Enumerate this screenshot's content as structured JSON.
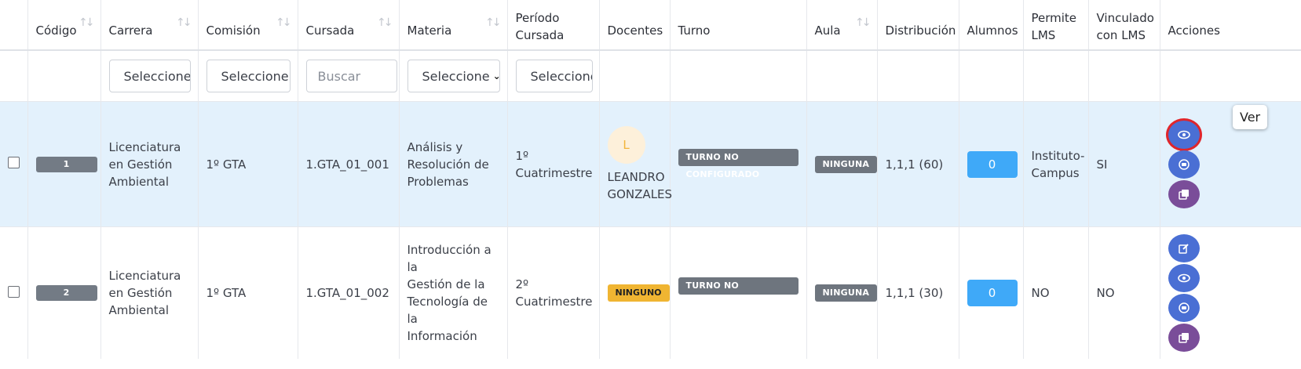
{
  "headers": {
    "codigo": "Código",
    "carrera": "Carrera",
    "comision": "Comisión",
    "cursada": "Cursada",
    "materia": "Materia",
    "periodo": [
      "Período",
      "Cursada"
    ],
    "docentes": "Docentes",
    "turno": "Turno",
    "aula": "Aula",
    "distribucion": "Distribución",
    "alumnos": "Alumnos",
    "permite": [
      "Permite",
      "LMS"
    ],
    "vinculado": [
      "Vinculado",
      "con LMS"
    ],
    "acciones": "Acciones"
  },
  "filters": {
    "carrera": "Seleccione",
    "comision": "Seleccione",
    "cursada_placeholder": "Buscar",
    "materia": "Seleccione",
    "periodo": "Seleccione"
  },
  "rows": [
    {
      "codigo": "1",
      "carrera": [
        "Licenciatura",
        "en Gestión",
        "Ambiental"
      ],
      "comision": "1º GTA",
      "cursada": "1.GTA_01_001",
      "materia": [
        "Análisis y",
        "Resolución de",
        "Problemas"
      ],
      "periodo": [
        "1º",
        "Cuatrimestre"
      ],
      "docente_initial": "L",
      "docente_name": [
        "LEANDRO",
        "GONZALES"
      ],
      "turno": "TURNO NO CONFIGURADO",
      "aula": "NINGUNA",
      "distribucion": "1,1,1 (60)",
      "alumnos": "0",
      "permite": [
        "Instituto-",
        "Campus"
      ],
      "vinculado": "SI"
    },
    {
      "codigo": "2",
      "carrera": [
        "Licenciatura",
        "en Gestión",
        "Ambiental"
      ],
      "comision": "1º GTA",
      "cursada": "1.GTA_01_002",
      "materia": [
        "Introducción a la",
        "Gestión de la",
        "Tecnología de la",
        "Información"
      ],
      "periodo": [
        "2º",
        "Cuatrimestre"
      ],
      "docente_badge": "NINGUNO",
      "turno": "TURNO NO CONFIGURADO",
      "aula": "NINGUNA",
      "distribucion": "1,1,1 (30)",
      "alumnos": "0",
      "permite": "NO",
      "vinculado": "NO"
    }
  ],
  "tooltip": "Ver",
  "sort_glyph": "↑↓",
  "select_chevron": "⌄",
  "icons": {
    "view": "eye-icon",
    "meet": "video-icon",
    "copy": "copy-icon",
    "edit": "edit-icon"
  }
}
